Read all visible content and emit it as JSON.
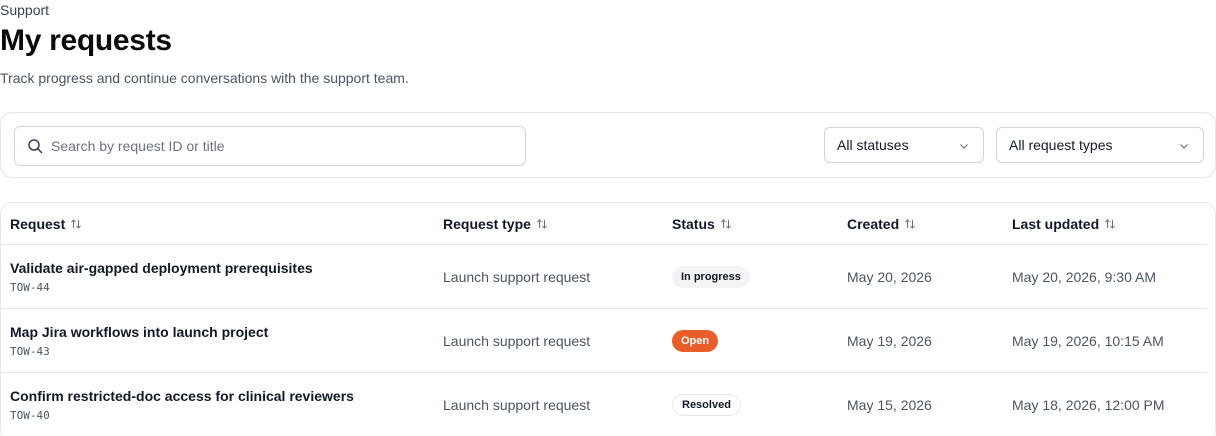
{
  "header": {
    "eyebrow": "Support",
    "title": "My requests",
    "subtitle": "Track progress and continue conversations with the support team."
  },
  "filters": {
    "search_placeholder": "Search by request ID or title",
    "search_value": "",
    "status_selected": "All statuses",
    "type_selected": "All request types"
  },
  "table": {
    "columns": [
      "Request",
      "Request type",
      "Status",
      "Created",
      "Last updated"
    ],
    "rows": [
      {
        "title": "Validate air-gapped deployment prerequisites",
        "id": "TOW-44",
        "type": "Launch support request",
        "status": "In progress",
        "created": "May 20, 2026",
        "updated": "May 20, 2026, 9:30 AM"
      },
      {
        "title": "Map Jira workflows into launch project",
        "id": "TOW-43",
        "type": "Launch support request",
        "status": "Open",
        "created": "May 19, 2026",
        "updated": "May 19, 2026, 10:15 AM"
      },
      {
        "title": "Confirm restricted-doc access for clinical reviewers",
        "id": "TOW-40",
        "type": "Launch support request",
        "status": "Resolved",
        "created": "May 15, 2026",
        "updated": "May 18, 2026, 12:00 PM"
      }
    ]
  },
  "colors": {
    "accent_open": "#e85d2a",
    "border": "#e5e7eb",
    "text": "#111827",
    "muted": "#4b5563"
  },
  "icons": {
    "search": "search-icon",
    "chevron": "chevron-down-icon",
    "sort": "sort-icon"
  }
}
